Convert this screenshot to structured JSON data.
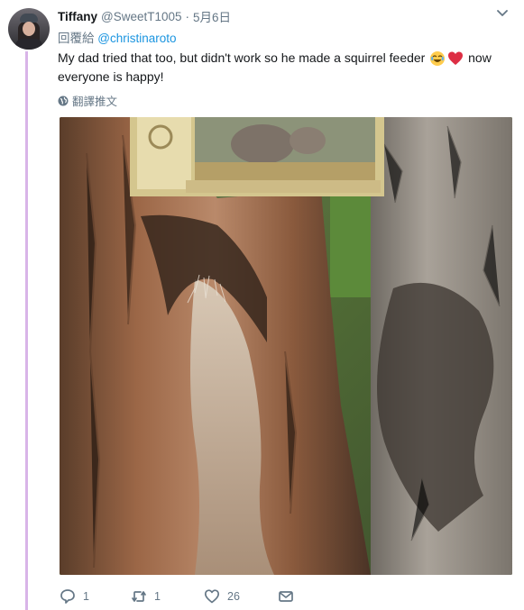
{
  "tweet": {
    "author_name": "Tiffany",
    "author_handle": "@SweetT1005",
    "separator": "·",
    "date": "5月6日",
    "reply_prefix": "回覆給",
    "reply_mention": "@christinaroto",
    "text_before_emoji": "My dad tried that too, but didn't work so he made a squirrel feeder",
    "text_after_emoji": "now everyone is happy!",
    "emoji": [
      "face-with-tears-of-joy",
      "red-heart"
    ],
    "translate_label": "翻譯推文",
    "photo_alt_icon": "photo-squirrel-feeder-tree",
    "accent_color": "#1b95e0",
    "thread_line_color": "#d8b4e8"
  },
  "actions": {
    "reply_count": "1",
    "retweet_count": "1",
    "like_count": "26"
  }
}
